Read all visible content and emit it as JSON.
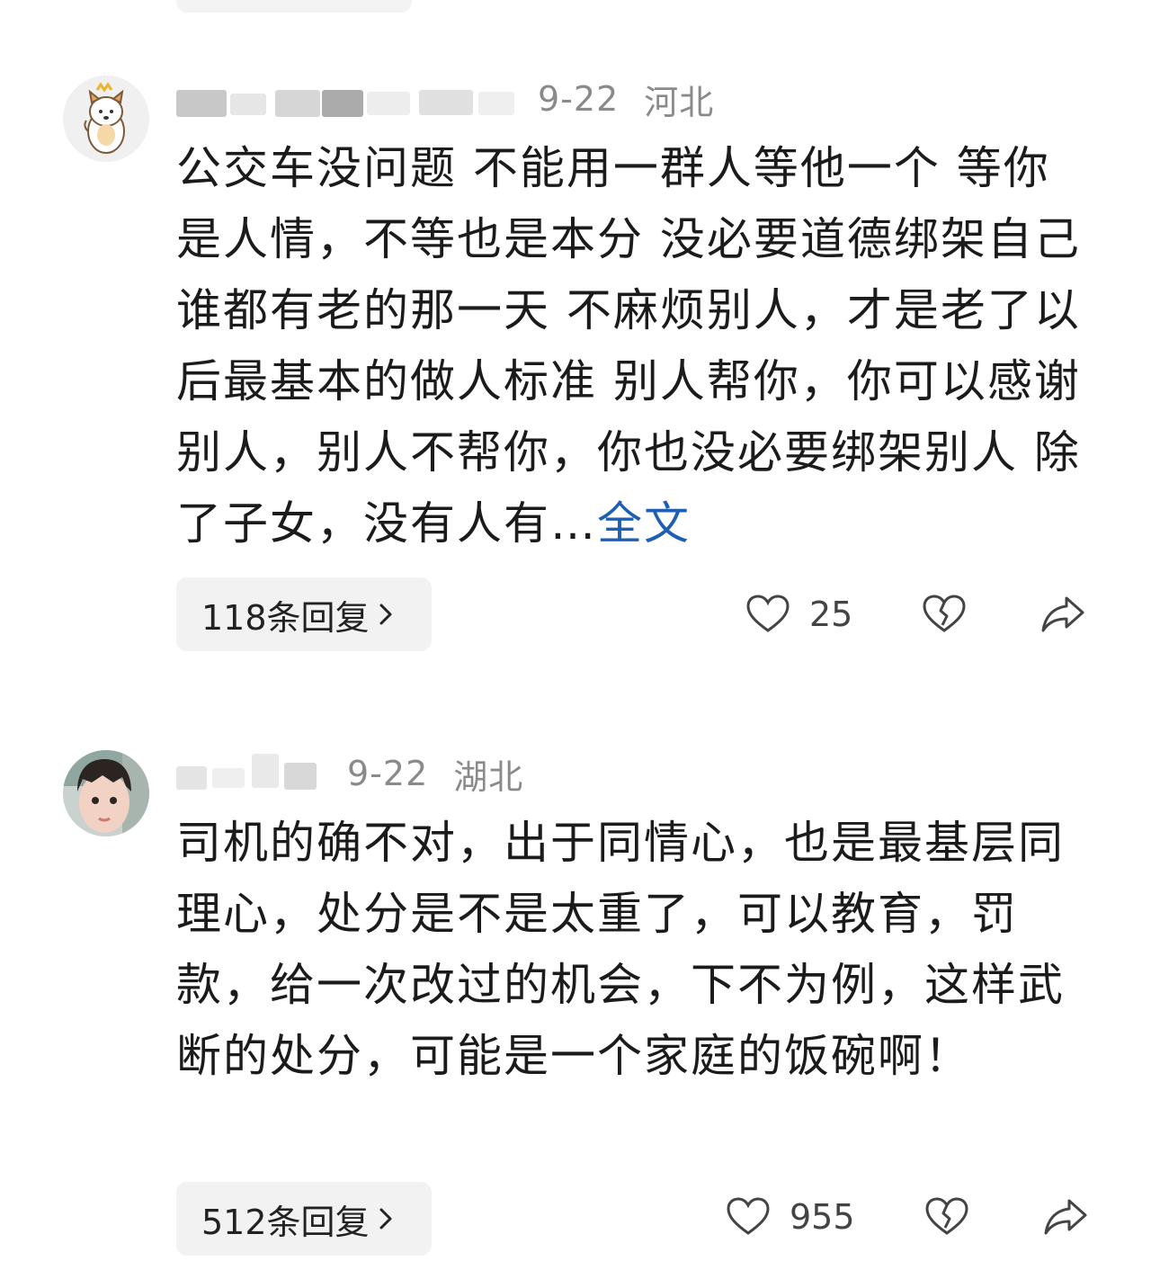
{
  "comments": [
    {
      "date": "9-22",
      "region": "河北",
      "content": "公交车没问题 不能用一群人等他一个 等你是人情，不等也是本分 没必要道德绑架自己 谁都有老的那一天 不麻烦别人，才是老了以后最基本的做人标准 别人帮你，你可以感谢别人，别人不帮你，你也没必要绑架别人 除了子女，没有人有…",
      "more_label": "全文",
      "replies_label": "118条回复",
      "like_count": "25",
      "avatar_icon": "dog-avatar-icon"
    },
    {
      "date": "9-22",
      "region": "湖北",
      "content": "司机的确不对，出于同情心，也是最基层同理心，处分是不是太重了，可以教育，罚款，给一次改过的机会，下不为例，这样武断的处分，可能是一个家庭的饭碗啊！",
      "replies_label": "512条回复",
      "like_count": "955",
      "avatar_icon": "child-photo-avatar"
    }
  ],
  "icons": [
    "heart-icon",
    "dislike-heart-icon",
    "share-icon",
    "chevron-right-icon"
  ],
  "colors": {
    "link": "#1f5fb3",
    "meta": "#8a8a8a",
    "text": "#1b1b1b",
    "pill": "#f2f2f2"
  }
}
